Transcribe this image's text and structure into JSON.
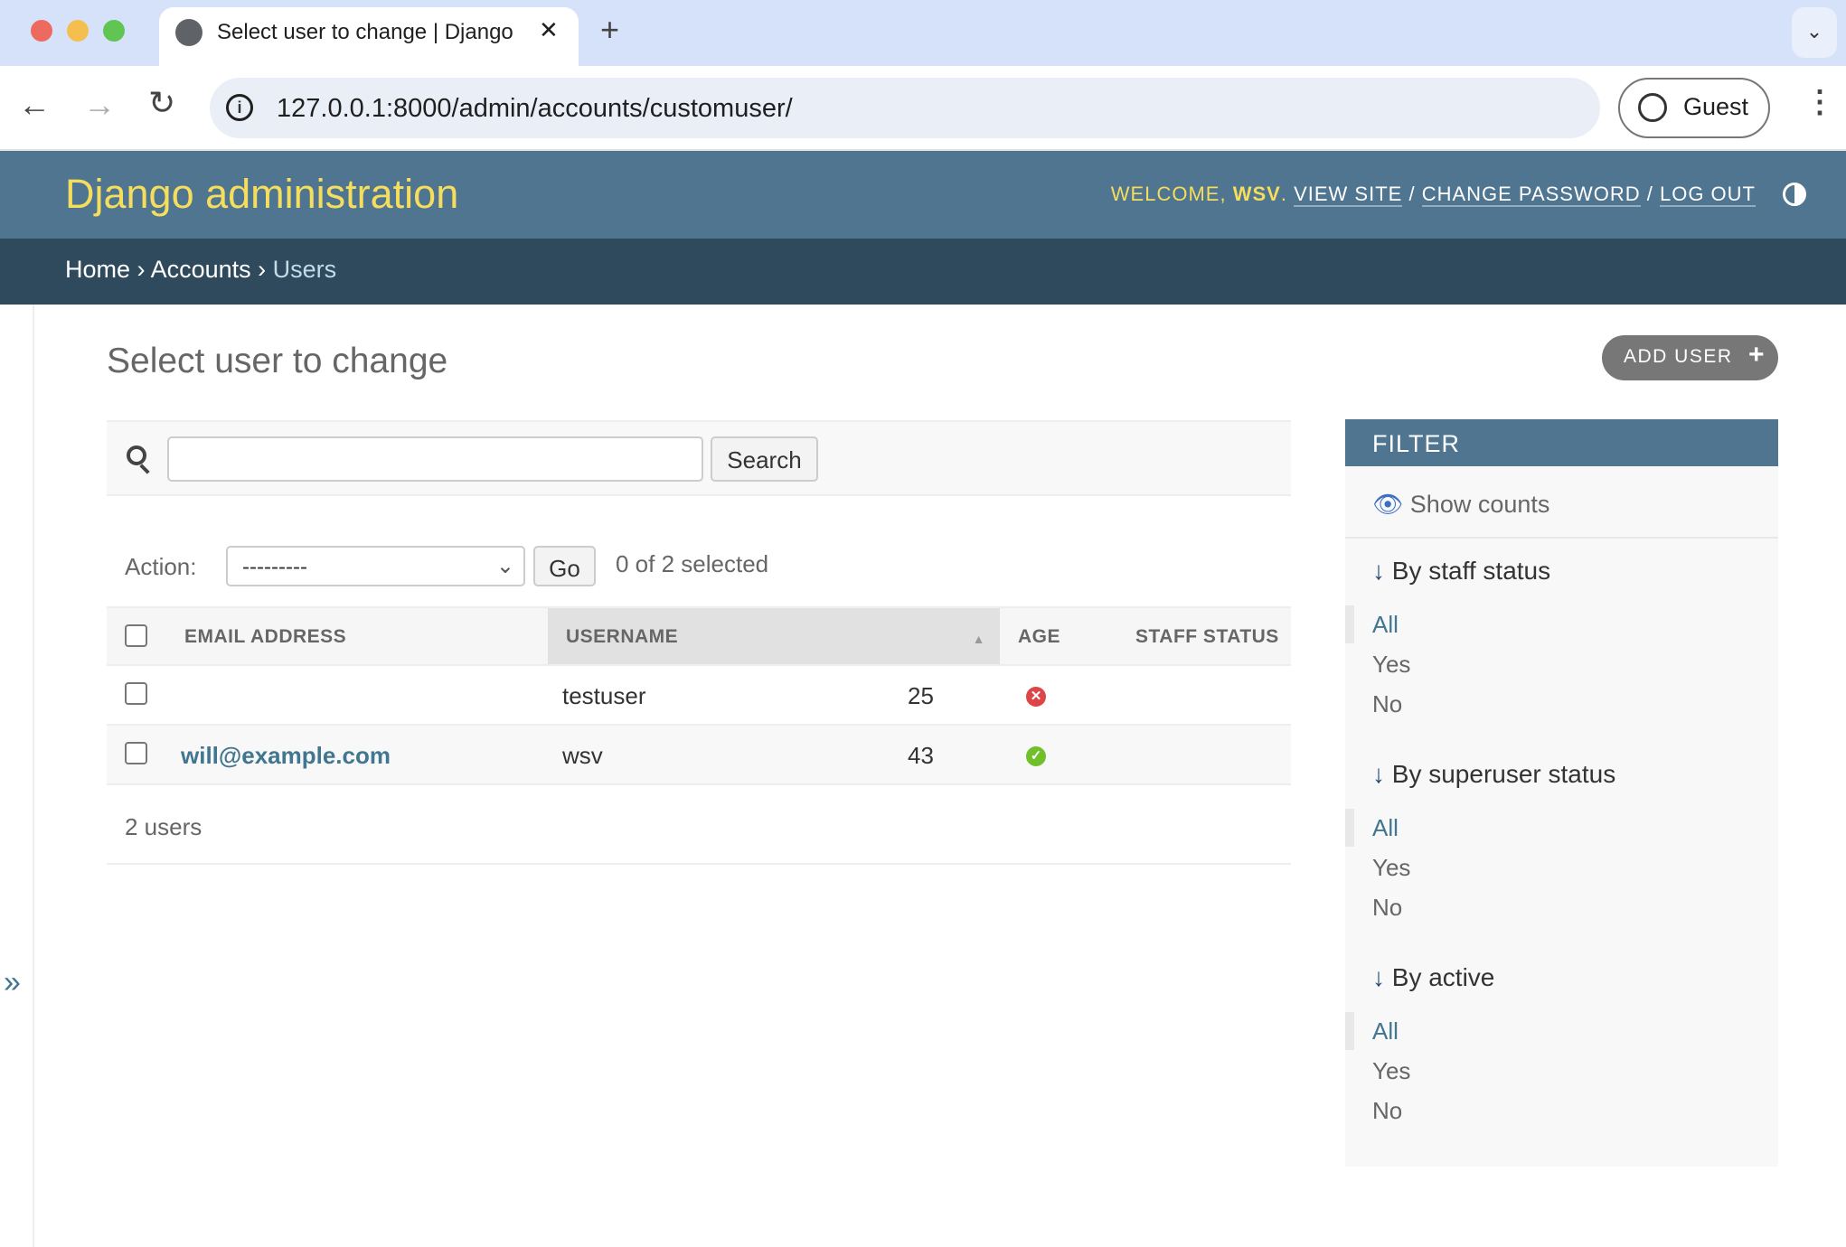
{
  "browser": {
    "tab_title": "Select user to change | Django site admin",
    "url": "127.0.0.1:8000/admin/accounts/customuser/",
    "profile": "Guest",
    "new_tab": "+",
    "close": "✕"
  },
  "header": {
    "brand": "Django administration",
    "welcome": "WELCOME,",
    "user": "WSV",
    "view_site": "VIEW SITE",
    "change_password": "CHANGE PASSWORD",
    "log_out": "LOG OUT"
  },
  "breadcrumbs": {
    "home": "Home",
    "app": "Accounts",
    "current": "Users",
    "sep": "›"
  },
  "nav_toggle": "»",
  "main": {
    "title": "Select user to change",
    "add_button": "ADD USER"
  },
  "search": {
    "button": "Search",
    "value": ""
  },
  "actions": {
    "label": "Action:",
    "selected_option": "---------",
    "go": "Go",
    "selection": "0 of 2 selected"
  },
  "table": {
    "headers": [
      "EMAIL ADDRESS",
      "USERNAME",
      "AGE",
      "STAFF STATUS"
    ],
    "sorted_by": "USERNAME",
    "sort_direction": "ascending",
    "rows": [
      {
        "email": "",
        "username": "testuser",
        "age": "25",
        "staff": false
      },
      {
        "email": "will@example.com",
        "username": "wsv",
        "age": "43",
        "staff": true
      }
    ]
  },
  "result_count": "2 users",
  "filter": {
    "title": "FILTER",
    "show_counts": "Show counts",
    "groups": [
      {
        "title": "By staff status",
        "items": [
          "All",
          "Yes",
          "No"
        ],
        "selected": "All"
      },
      {
        "title": "By superuser status",
        "items": [
          "All",
          "Yes",
          "No"
        ],
        "selected": "All"
      },
      {
        "title": "By active",
        "items": [
          "All",
          "Yes",
          "No"
        ],
        "selected": "All"
      }
    ]
  },
  "colors": {
    "header": "#4f7590",
    "breadcrumbs": "#2f4a5d",
    "brand": "#f5dd5d",
    "link": "#417690",
    "yes": "#70bf2b",
    "no": "#dd4646"
  }
}
